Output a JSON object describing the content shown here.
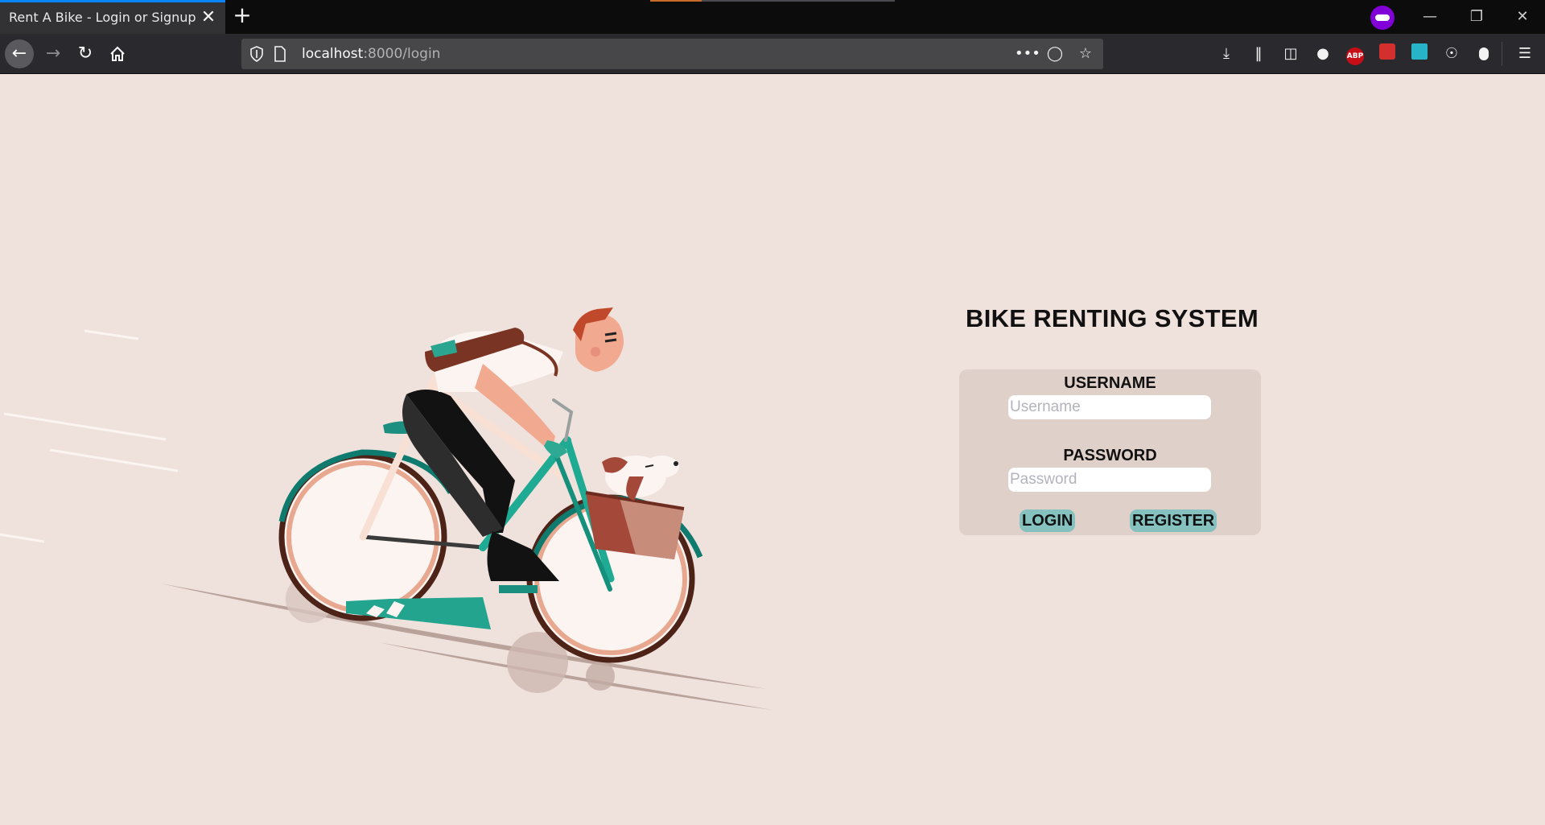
{
  "browser": {
    "tab_title": "Rent A Bike - Login or Signup",
    "tab_close": "✕",
    "new_tab": "+",
    "url_host": "localhost",
    "url_rest": ":8000/login",
    "url_more": "•••"
  },
  "page": {
    "title": "BIKE RENTING SYSTEM",
    "username_label": "USERNAME",
    "username_placeholder": "Username",
    "password_label": "PASSWORD",
    "password_placeholder": "Password",
    "login_label": "LOGIN",
    "register_label": "REGISTER"
  },
  "colors": {
    "page_bg": "#efe1db",
    "panel_bg": "#dfd0ca",
    "button_bg": "#84c1bf",
    "accent_teal": "#1a9b8a"
  }
}
